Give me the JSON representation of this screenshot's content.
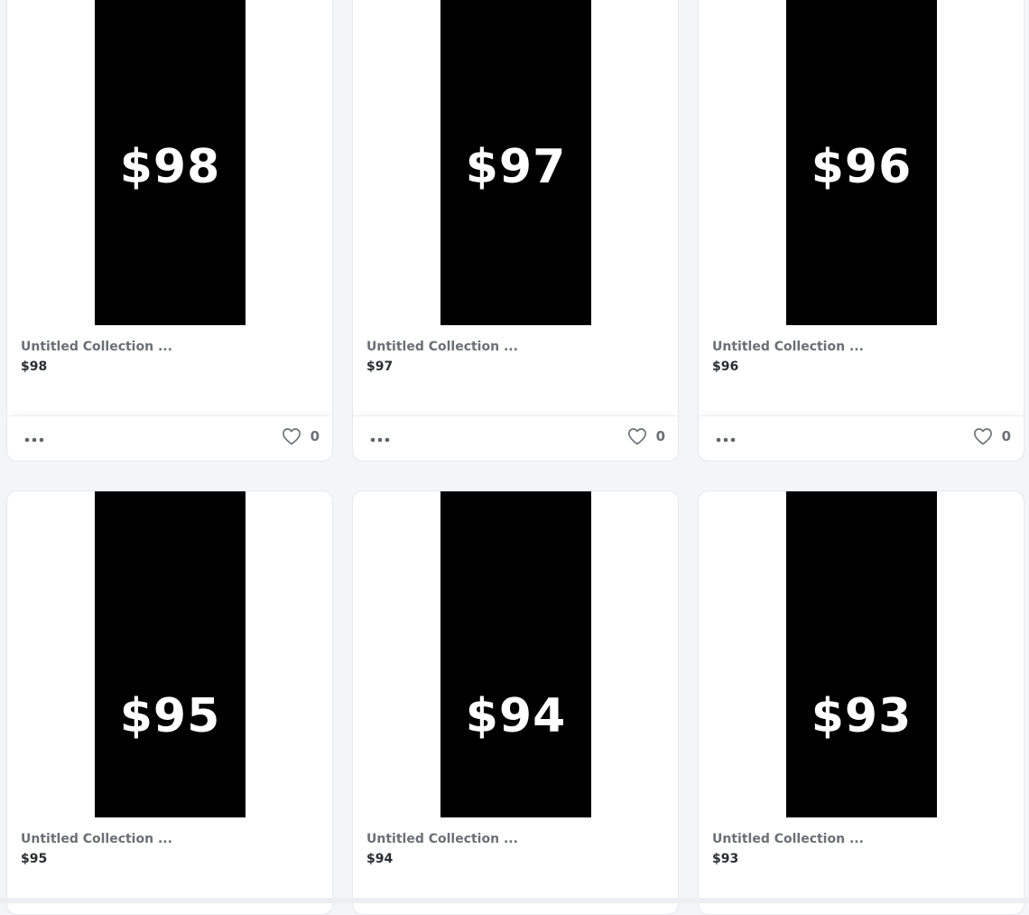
{
  "items": [
    {
      "thumb_label": "$98",
      "title": "Untitled Collection ...",
      "price": "$98",
      "likes": "0"
    },
    {
      "thumb_label": "$97",
      "title": "Untitled Collection ...",
      "price": "$97",
      "likes": "0"
    },
    {
      "thumb_label": "$96",
      "title": "Untitled Collection ...",
      "price": "$96",
      "likes": "0"
    },
    {
      "thumb_label": "$95",
      "title": "Untitled Collection ...",
      "price": "$95"
    },
    {
      "thumb_label": "$94",
      "title": "Untitled Collection ...",
      "price": "$94"
    },
    {
      "thumb_label": "$93",
      "title": "Untitled Collection ...",
      "price": "$93"
    }
  ],
  "icons": {
    "more": "more-horizontal-icon",
    "like": "heart-icon"
  },
  "colors": {
    "thumb_background": "#000000",
    "thumb_text": "#ffffff",
    "title_text": "#6b6f76",
    "price_text": "#2a2d31"
  }
}
